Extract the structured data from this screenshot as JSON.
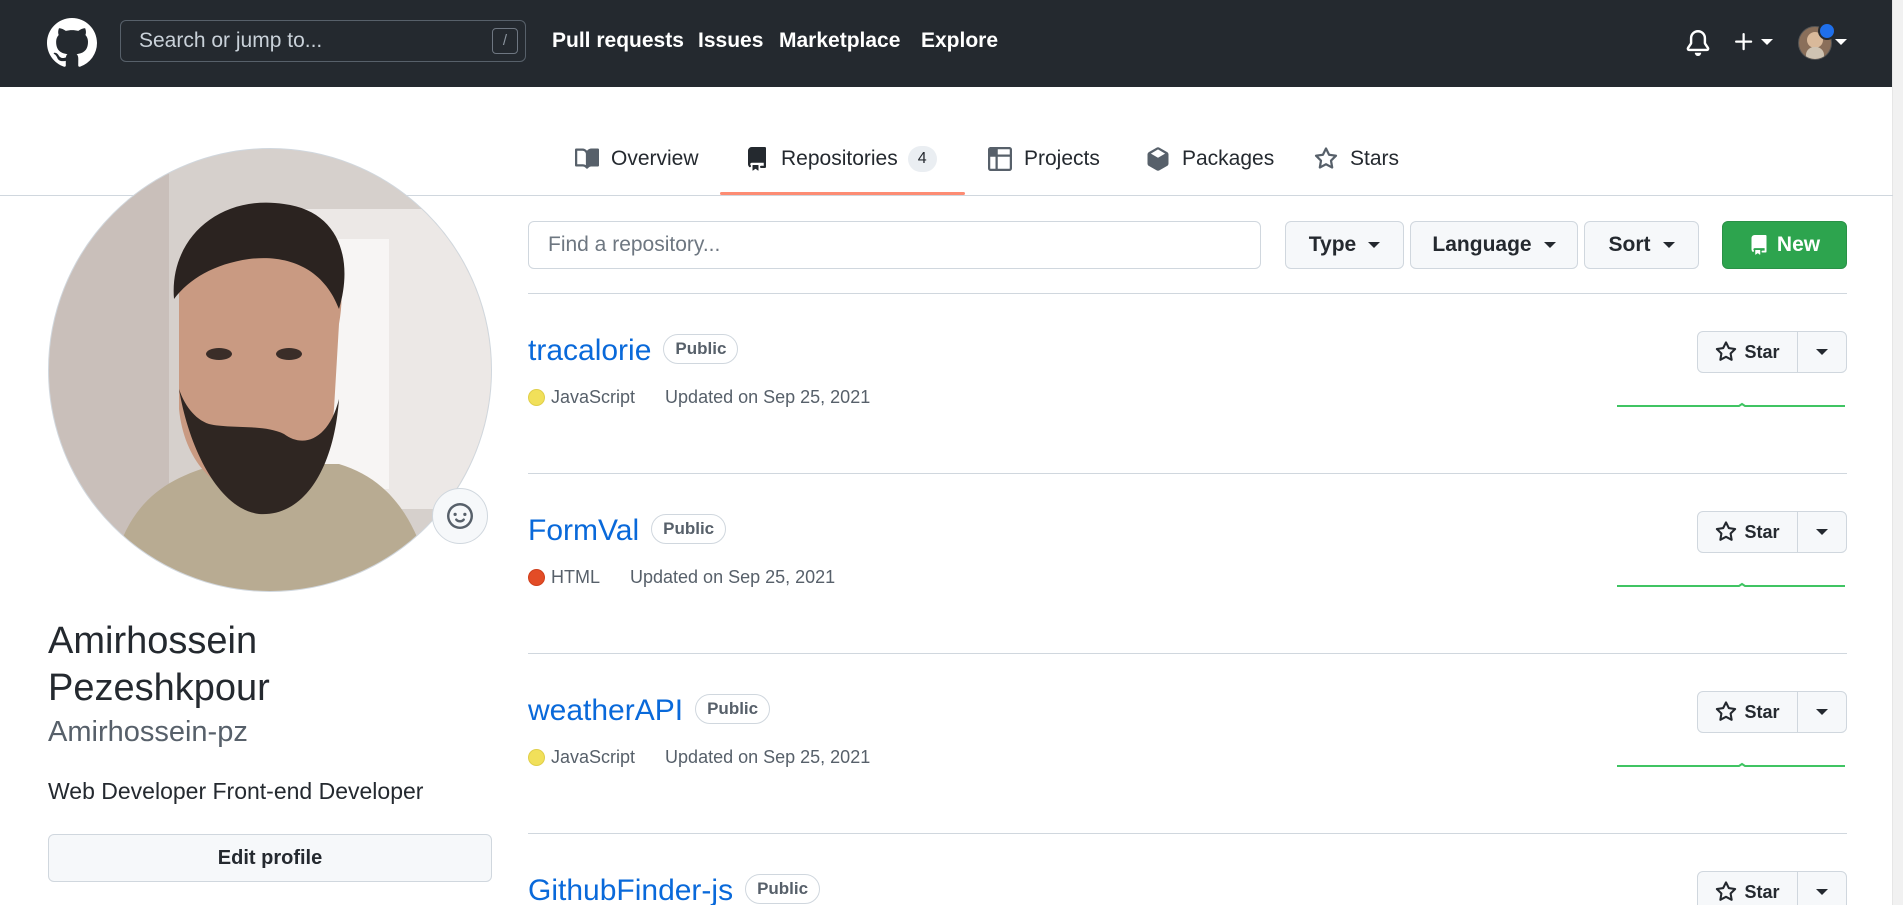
{
  "header": {
    "logo_icon": "github-octocat-icon",
    "search_placeholder": "Search or jump to...",
    "search_shortcut": "/",
    "nav": [
      "Pull requests",
      "Issues",
      "Marketplace",
      "Explore"
    ],
    "icons": [
      "bell-icon",
      "plus-icon",
      "avatar"
    ]
  },
  "tabs": [
    {
      "label": "Overview",
      "icon": "book-icon"
    },
    {
      "label": "Repositories",
      "icon": "repo-icon",
      "count": "4"
    },
    {
      "label": "Projects",
      "icon": "table-icon"
    },
    {
      "label": "Packages",
      "icon": "package-icon"
    },
    {
      "label": "Stars",
      "icon": "star-icon"
    }
  ],
  "profile": {
    "name": "Amirhossein Pezeshkpour",
    "login": "Amirhossein-pz",
    "bio": "Web Developer Front-end Developer",
    "edit_label": "Edit profile"
  },
  "filters": {
    "find_placeholder": "Find a repository...",
    "type_label": "Type",
    "language_label": "Language",
    "sort_label": "Sort",
    "new_label": "New"
  },
  "repos": [
    {
      "name": "tracalorie",
      "visibility": "Public",
      "language": "JavaScript",
      "lang_color": "#f1e05a",
      "updated": "Updated on Sep 25, 2021",
      "star_label": "Star"
    },
    {
      "name": "FormVal",
      "visibility": "Public",
      "language": "HTML",
      "lang_color": "#e34c26",
      "updated": "Updated on Sep 25, 2021",
      "star_label": "Star"
    },
    {
      "name": "weatherAPI",
      "visibility": "Public",
      "language": "JavaScript",
      "lang_color": "#f1e05a",
      "updated": "Updated on Sep 25, 2021",
      "star_label": "Star"
    },
    {
      "name": "GithubFinder-js",
      "visibility": "Public",
      "star_label": "Star"
    }
  ],
  "colors": {
    "header_bg": "#24292f",
    "link": "#0969da",
    "new_button": "#2da44e",
    "tab_underline": "#fd8c73",
    "sparkline": "#40c463"
  }
}
